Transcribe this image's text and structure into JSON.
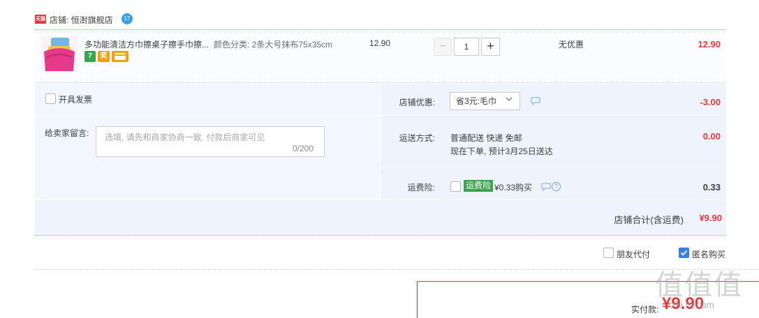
{
  "shop": {
    "logo_text": "天猫",
    "label": "店铺: 恒澍旗舰店",
    "badge": "17"
  },
  "item": {
    "title": "多功能清洁方巾擦桌子擦手巾擦...",
    "sku": "颜色分类: 2条大号抹布75x35cm",
    "tags": [
      "7",
      "奖",
      ""
    ],
    "unit_price": "12.90",
    "quantity": "1",
    "qty_minus": "−",
    "qty_plus": "+",
    "discount": "无优惠",
    "subtotal": "12.90"
  },
  "invoice": {
    "label": "开具发票"
  },
  "message": {
    "label": "给卖家留言:",
    "placeholder": "选填, 请先和商家协商一致, 付款后商家可见",
    "counter": "0/200"
  },
  "coupon": {
    "label": "店铺优惠:",
    "selected": "省3元:毛巾",
    "value": "-3.00"
  },
  "shipping": {
    "label": "运送方式:",
    "method": "普通配送 快递 免邮",
    "eta": "现在下单, 预计3月25日送达",
    "value": "0.00"
  },
  "insurance": {
    "label": "运费险:",
    "badge": "运费险",
    "text": "¥0.33购买",
    "help": "?",
    "value": "0.33"
  },
  "shop_total": {
    "label": "店铺合计(含运费)",
    "value": "¥9.90"
  },
  "options": {
    "friend_pay": "朋友代付",
    "anonymous": "匿名购买"
  },
  "payment": {
    "label": "实付款:",
    "amount": "¥9.90"
  },
  "watermark": {
    "text": "值值值",
    "url": "zhi.bi.com"
  },
  "colors": {
    "accent_red": "#e4393c",
    "link_blue": "#3a7de0",
    "panel_blue": "#eef3fd",
    "badge_green": "#3ba24d"
  }
}
